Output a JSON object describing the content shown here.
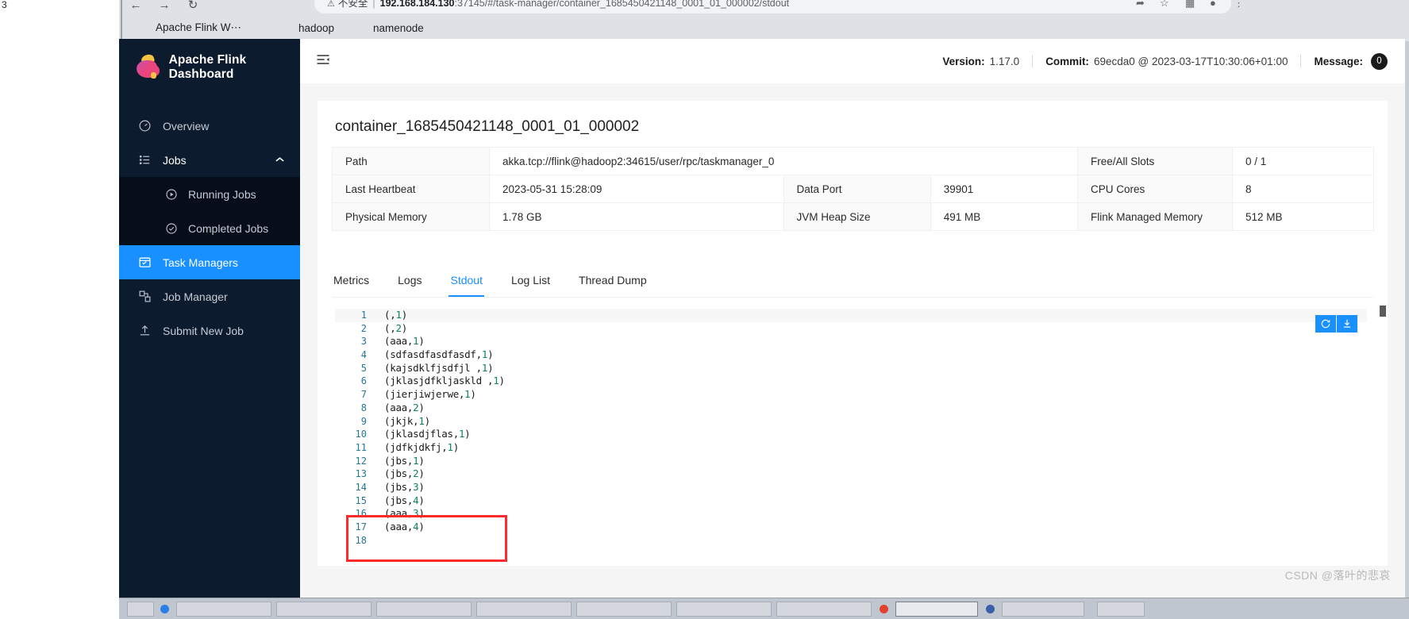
{
  "browser": {
    "left_margin_text": "3",
    "nav": {
      "back": "←",
      "forward": "→",
      "reload": "↻"
    },
    "omnibox": {
      "security_icon": "not-secure-warning-icon",
      "security_label": "不安全",
      "url_host": "192.168.184.130",
      "url_rest": ":37145/#/task-manager/container_1685450421148_0001_01_000002/stdout"
    },
    "right_icons": [
      "share-icon",
      "star-icon",
      "extensions-icon",
      "profile-icon",
      "menu-icon"
    ],
    "bookmarks": [
      {
        "label": "Apache Flink W⋯",
        "icon": "flink-favicon"
      },
      {
        "label": "hadoop",
        "icon": "globe-icon"
      },
      {
        "label": "namenode",
        "icon": "globe-icon"
      }
    ]
  },
  "sidebar": {
    "brand": "Apache Flink Dashboard",
    "items": [
      {
        "label": "Overview",
        "icon": "dashboard-gauge-icon",
        "state": "normal"
      },
      {
        "label": "Jobs",
        "icon": "list-icon",
        "state": "expanded"
      },
      {
        "label": "Running Jobs",
        "icon": "play-circle-icon",
        "state": "sub"
      },
      {
        "label": "Completed Jobs",
        "icon": "check-circle-icon",
        "state": "sub"
      },
      {
        "label": "Task Managers",
        "icon": "task-board-icon",
        "state": "active"
      },
      {
        "label": "Job Manager",
        "icon": "cluster-icon",
        "state": "normal"
      },
      {
        "label": "Submit New Job",
        "icon": "upload-icon",
        "state": "normal"
      }
    ]
  },
  "topbar": {
    "collapse_icon": "menu-fold-icon",
    "version_label": "Version:",
    "version_value": "1.17.0",
    "commit_label": "Commit:",
    "commit_value": "69ecda0 @ 2023-03-17T10:30:06+01:00",
    "message_label": "Message:",
    "message_count": "0"
  },
  "main": {
    "title": "container_1685450421148_0001_01_000002",
    "info_rows": [
      [
        {
          "k": "Path",
          "v": "akka.tcp://flink@hadoop2:34615/user/rpc/taskmanager_0",
          "span": 3
        },
        {
          "k": "Free/All Slots",
          "v": "0 / 1"
        }
      ],
      [
        {
          "k": "Last Heartbeat",
          "v": "2023-05-31 15:28:09"
        },
        {
          "k": "Data Port",
          "v": "39901"
        },
        {
          "k": "CPU Cores",
          "v": "8"
        }
      ],
      [
        {
          "k": "Physical Memory",
          "v": "1.78 GB"
        },
        {
          "k": "JVM Heap Size",
          "v": "491 MB"
        },
        {
          "k": "Flink Managed Memory",
          "v": "512 MB"
        }
      ]
    ],
    "tabs": [
      {
        "label": "Metrics",
        "active": false
      },
      {
        "label": "Logs",
        "active": false
      },
      {
        "label": "Stdout",
        "active": true
      },
      {
        "label": "Log List",
        "active": false
      },
      {
        "label": "Thread Dump",
        "active": false
      }
    ],
    "log_toolbar": [
      {
        "name": "refresh-button",
        "glyph": "⟳"
      },
      {
        "name": "download-button",
        "glyph": "⤓"
      }
    ],
    "stdout_lines": [
      {
        "n": "1",
        "text": "(,1)",
        "nums": [
          "1"
        ]
      },
      {
        "n": "2",
        "text": "(,2)",
        "nums": [
          "2"
        ]
      },
      {
        "n": "3",
        "text": "(aaa,1)",
        "nums": [
          "1"
        ]
      },
      {
        "n": "4",
        "text": "(sdfasdfasdfasdf,1)",
        "nums": [
          "1"
        ]
      },
      {
        "n": "5",
        "text": "(kajsdklfjsdfjl ,1)",
        "nums": [
          "1"
        ]
      },
      {
        "n": "6",
        "text": "(jklasjdfkljaskld ,1)",
        "nums": [
          "1"
        ]
      },
      {
        "n": "7",
        "text": "(jierjiwjerwe,1)",
        "nums": [
          "1"
        ]
      },
      {
        "n": "8",
        "text": "(aaa,2)",
        "nums": [
          "2"
        ]
      },
      {
        "n": "9",
        "text": "(jkjk,1)",
        "nums": [
          "1"
        ]
      },
      {
        "n": "10",
        "text": "(jklasdjflas,1)",
        "nums": [
          "1"
        ]
      },
      {
        "n": "11",
        "text": "(jdfkjdkfj,1)",
        "nums": [
          "1"
        ]
      },
      {
        "n": "12",
        "text": "(jbs,1)",
        "nums": [
          "1"
        ]
      },
      {
        "n": "13",
        "text": "(jbs,2)",
        "nums": [
          "2"
        ]
      },
      {
        "n": "14",
        "text": "(jbs,3)",
        "nums": [
          "3"
        ]
      },
      {
        "n": "15",
        "text": "(jbs,4)",
        "nums": [
          "4"
        ]
      },
      {
        "n": "16",
        "text": "(aaa,3)",
        "nums": [
          "3"
        ]
      },
      {
        "n": "17",
        "text": "(aaa,4)",
        "nums": [
          "4"
        ]
      },
      {
        "n": "18",
        "text": "",
        "nums": []
      }
    ],
    "highlight_note": "red-annotation-box-lines-12-to-15"
  },
  "watermark": "CSDN @落叶的悲哀",
  "colors": {
    "accent": "#1890ff",
    "sidebar_bg": "#0d1b2e",
    "sidebar_sub_bg": "#060e1a",
    "annotation_red": "#fd2b2b",
    "code_number": "#098658",
    "gutter": "#237893"
  }
}
